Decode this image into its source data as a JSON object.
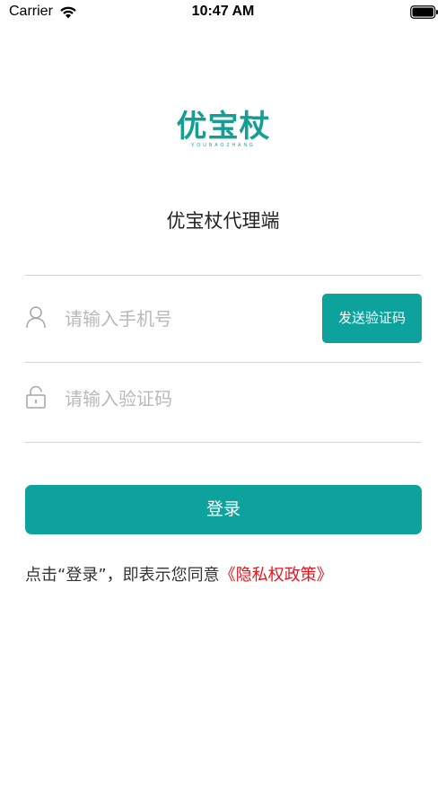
{
  "status_bar": {
    "carrier": "Carrier",
    "time": "10:47 AM"
  },
  "logo": {
    "text": "优宝杖",
    "subtext": "YOUBAOZHANG",
    "color": "#169e95"
  },
  "app_title": "优宝杖代理端",
  "phone_field": {
    "icon": "user-icon",
    "placeholder": "请输入手机号",
    "value": ""
  },
  "send_code_button": {
    "label": "发送验证码"
  },
  "code_field": {
    "icon": "lock-icon",
    "placeholder": "请输入验证码",
    "value": ""
  },
  "login_button": {
    "label": "登录"
  },
  "agreement": {
    "prefix": "点击“登录”，即表示您同意",
    "link": "《隐私权政策》"
  },
  "colors": {
    "accent": "#0ea29d",
    "link": "#e8141c",
    "placeholder": "#b9b9b9",
    "divider": "#d4d4d4"
  }
}
